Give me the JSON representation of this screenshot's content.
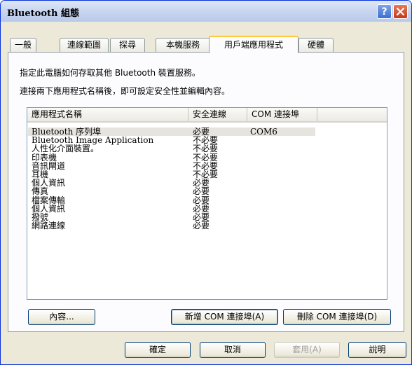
{
  "window": {
    "title": "Bluetooth 組態"
  },
  "tabs": [
    {
      "label": "一般"
    },
    {
      "label": "連線範圍"
    },
    {
      "label": "探尋"
    },
    {
      "label": "本機服務"
    },
    {
      "label": "用戶端應用程式",
      "active": true
    },
    {
      "label": "硬體"
    }
  ],
  "panel": {
    "description_line1": "指定此電腦如何存取其他 Bluetooth 裝置服務。",
    "description_line2": "連接兩下應用程式名稱後，即可設定安全性並編輯內容。"
  },
  "list": {
    "columns": [
      "應用程式名稱",
      "安全連線",
      "COM 連接埠"
    ],
    "rows": [
      {
        "name": "Bluetooth 序列埠",
        "secure": "必要",
        "com": "COM6",
        "selected": true
      },
      {
        "name": "Bluetooth Image Application",
        "secure": "不必要",
        "com": ""
      },
      {
        "name": "人性化介面裝置。",
        "secure": "不必要",
        "com": ""
      },
      {
        "name": "印表機",
        "secure": "不必要",
        "com": ""
      },
      {
        "name": "音訊閘道",
        "secure": "不必要",
        "com": ""
      },
      {
        "name": "耳機",
        "secure": "不必要",
        "com": ""
      },
      {
        "name": "個人資訊",
        "secure": "必要",
        "com": ""
      },
      {
        "name": "傳真",
        "secure": "必要",
        "com": ""
      },
      {
        "name": "檔案傳輸",
        "secure": "必要",
        "com": ""
      },
      {
        "name": "個人資訊",
        "secure": "必要",
        "com": ""
      },
      {
        "name": "撥號",
        "secure": "必要",
        "com": ""
      },
      {
        "name": "網路連線",
        "secure": "必要",
        "com": ""
      }
    ]
  },
  "panel_buttons": {
    "properties": "內容...",
    "add_com": "新增 COM 連接埠(A)",
    "remove_com": "刪除 COM 連接埠(D)"
  },
  "dialog_buttons": {
    "ok": "確定",
    "cancel": "取消",
    "apply": "套用(A)",
    "help": "說明"
  },
  "icons": {
    "help": "question-mark-icon",
    "close": "close-x-icon"
  }
}
